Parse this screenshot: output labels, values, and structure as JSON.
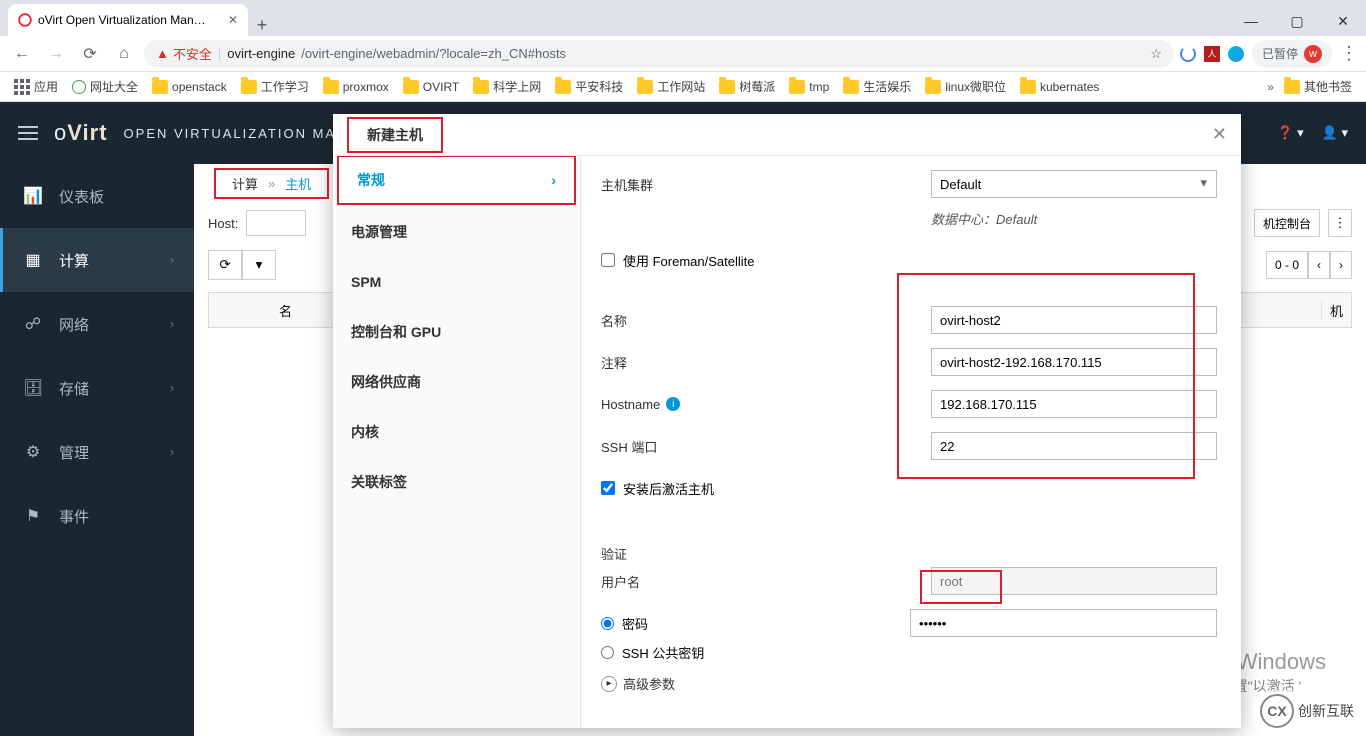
{
  "browser": {
    "tab_title": "oVirt Open Virtualization Man…",
    "insecure_label": "不安全",
    "url_host": "ovirt-engine",
    "url_path": "/ovirt-engine/webadmin/?locale=zh_CN#hosts",
    "paused_label": "已暂停",
    "avatar_letter": "w"
  },
  "bookmarks": {
    "apps": "应用",
    "items": [
      "网址大全",
      "openstack",
      "工作学习",
      "proxmox",
      "OVIRT",
      "科学上网",
      "平安科技",
      "工作网站",
      "树莓派",
      "tmp",
      "生活娱乐",
      "linux微职位",
      "kubernates"
    ],
    "other": "其他书签"
  },
  "ovirt": {
    "product": "OPEN VIRTUALIZATION MANAG"
  },
  "sidebar": {
    "items": [
      {
        "icon": "📊",
        "label": "仪表板",
        "has_sub": false
      },
      {
        "icon": "▦",
        "label": "计算",
        "has_sub": true,
        "active": true
      },
      {
        "icon": "☍",
        "label": "网络",
        "has_sub": true
      },
      {
        "icon": "🗄",
        "label": "存储",
        "has_sub": true
      },
      {
        "icon": "⚙",
        "label": "管理",
        "has_sub": true
      },
      {
        "icon": "⚑",
        "label": "事件",
        "has_sub": false
      }
    ]
  },
  "breadcrumb": {
    "a": "计算",
    "sep": "»",
    "b": "主机"
  },
  "grid": {
    "filter_label": "Host:",
    "console_btn": "机控制台",
    "pager": "0 - 0",
    "col_name": "名"
  },
  "modal": {
    "title": "新建主机",
    "nav": [
      "常规",
      "电源管理",
      "SPM",
      "控制台和 GPU",
      "网络供应商",
      "内核",
      "关联标签"
    ],
    "labels": {
      "cluster": "主机集群",
      "dc_prefix": "数据中心：",
      "dc": "Default",
      "foreman": "使用 Foreman/Satellite",
      "name": "名称",
      "comment": "注释",
      "hostname": "Hostname",
      "ssh": "SSH 端口",
      "activate": "安装后激活主机",
      "auth": "验证",
      "user": "用户名",
      "pwd": "密码",
      "pubkey": "SSH 公共密钥",
      "adv": "高级参数"
    },
    "values": {
      "cluster": "Default",
      "name": "ovirt-host2",
      "comment": "ovirt-host2-192.168.170.115",
      "hostname": "192.168.170.115",
      "ssh": "22",
      "user": "root",
      "pwd": "••••••"
    }
  },
  "watermark": {
    "l1": "激活 Windows",
    "l2": "转到\"设置\"以激活 '"
  },
  "brand": "创新互联"
}
